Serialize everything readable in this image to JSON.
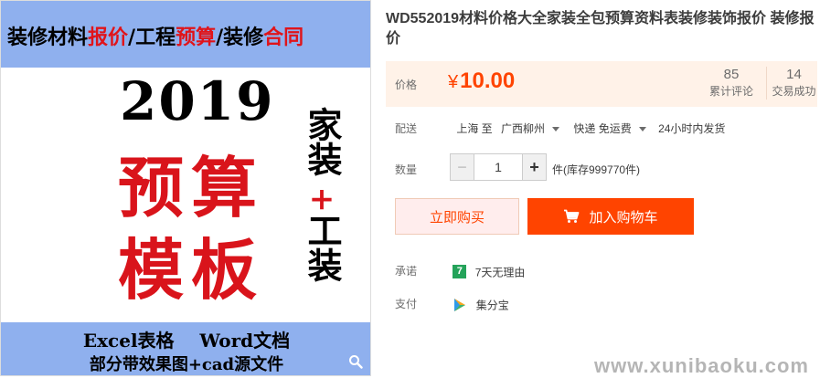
{
  "product_image": {
    "header_parts": [
      {
        "text": "装修材料",
        "color": "#000000"
      },
      {
        "text": "报价",
        "color": "#e0141a"
      },
      {
        "text": "/工程",
        "color": "#000000"
      },
      {
        "text": "预算",
        "color": "#e0141a"
      },
      {
        "text": "/装修",
        "color": "#000000"
      },
      {
        "text": "合同",
        "color": "#e0141a"
      }
    ],
    "year": "2019",
    "big_line_1": "预算",
    "big_line_2": "模板",
    "vertical_top": "家装",
    "vertical_plus": "+",
    "vertical_bottom": "工装",
    "footer_line_1": "Excel表格    Word文档",
    "footer_line_2": "部分带效果图+cad源文件",
    "zoom_icon": "magnifier-icon"
  },
  "title": "WD552019材料价格大全家装全包预算资料表装修装饰报价 装修报价",
  "price": {
    "label": "价格",
    "currency": "¥",
    "value": "10.00",
    "reviews_count": "85",
    "reviews_label": "累计评论",
    "trades_count": "14",
    "trades_label": "交易成功"
  },
  "shipping": {
    "label": "配送",
    "from": "上海 至",
    "to": "广西柳州",
    "method": "快递 免运费",
    "dispatch": "24小时内发货"
  },
  "quantity": {
    "label": "数量",
    "value": "1",
    "minus": "−",
    "plus": "+",
    "stock": "件(库存999770件)"
  },
  "buttons": {
    "buy_now": "立即购买",
    "add_cart": "加入购物车"
  },
  "promise": {
    "label": "承诺",
    "badge": "7",
    "text": "7天无理由"
  },
  "payment": {
    "label": "支付",
    "text": "集分宝"
  },
  "watermark": "www.xunibaoku.com",
  "colors": {
    "accent": "#ff4400",
    "price_bg": "#fff2e8",
    "image_band": "#8fb0ee",
    "promise_green": "#24a35a"
  }
}
